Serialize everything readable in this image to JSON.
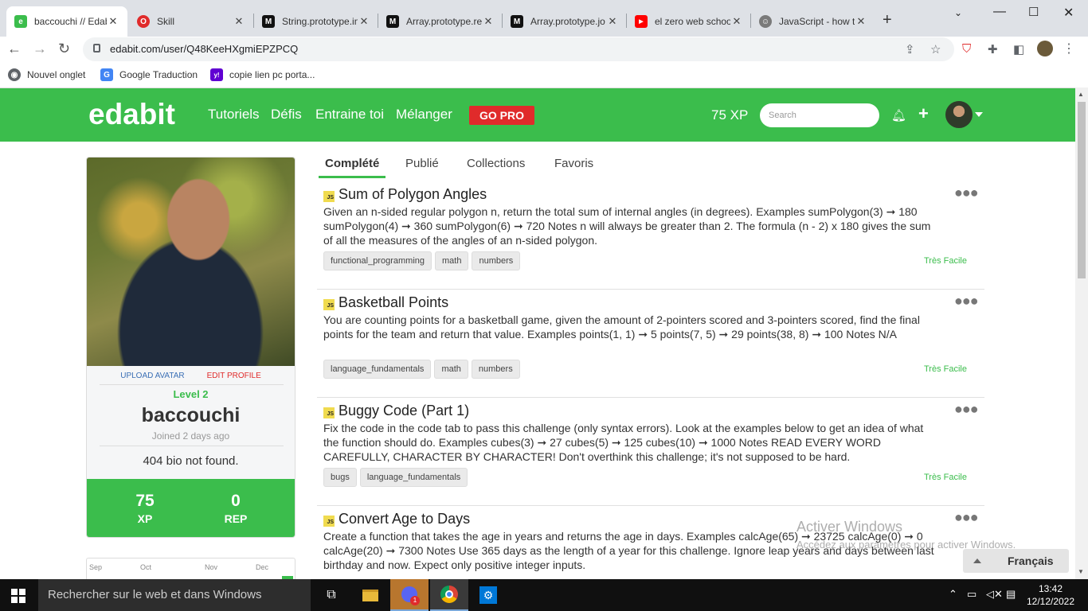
{
  "browser": {
    "tabs": [
      {
        "title": "baccouchi // Edabit",
        "fav_color": "#3bbd4c",
        "fav_glyph": "e"
      },
      {
        "title": "Skill",
        "fav_color": "#e02b2b",
        "fav_glyph": "O"
      },
      {
        "title": "String.prototype.in",
        "fav_color": "#111111",
        "fav_glyph": "M"
      },
      {
        "title": "Array.prototype.re",
        "fav_color": "#111111",
        "fav_glyph": "M"
      },
      {
        "title": "Array.prototype.jo",
        "fav_color": "#111111",
        "fav_glyph": "M"
      },
      {
        "title": "el zero web schoo",
        "fav_color": "#ff0000",
        "fav_glyph": "▶"
      },
      {
        "title": "JavaScript - how t",
        "fav_color": "#7a7a7a",
        "fav_glyph": "☺"
      }
    ],
    "url": "edabit.com/user/Q48KeeHXgmiEPZPCQ",
    "bookmarks": [
      {
        "label": "Nouvel onglet",
        "color": "#5f6368",
        "glyph": "◉"
      },
      {
        "label": "Google Traduction",
        "color": "#4285f4",
        "glyph": "G"
      },
      {
        "label": "copie lien pc porta...",
        "color": "#6001d2",
        "glyph": "y!"
      }
    ]
  },
  "site": {
    "logo": "edabit",
    "nav": [
      "Tutoriels",
      "Défis",
      "Entraine toi",
      "Mélanger"
    ],
    "gopro": "GO PRO",
    "xp": "75 XP",
    "search_placeholder": "Search"
  },
  "profile": {
    "upload_avatar": "UPLOAD AVATAR",
    "edit_profile": "EDIT PROFILE",
    "level": "Level 2",
    "username": "baccouchi",
    "joined": "Joined 2 days ago",
    "bio": "404 bio not found.",
    "xp_value": "75",
    "xp_label": "XP",
    "rep_value": "0",
    "rep_label": "REP",
    "activity_months": [
      "Sep",
      "Oct",
      "Nov",
      "Dec"
    ]
  },
  "profile_tabs": [
    "Complété",
    "Publié",
    "Collections",
    "Favoris"
  ],
  "challenges": [
    {
      "lang": "JS",
      "title": "Sum of Polygon Angles",
      "desc": "Given an n-sided regular polygon n, return the total sum of internal angles (in degrees). Examples sumPolygon(3) ➞ 180 sumPolygon(4) ➞ 360 sumPolygon(6) ➞ 720 Notes n will always be greater than 2. The formula (n - 2) x 180 gives the sum of all the measures of the angles of an n-sided polygon.",
      "tags": [
        "functional_programming",
        "math",
        "numbers"
      ],
      "difficulty": "Très Facile"
    },
    {
      "lang": "JS",
      "title": "Basketball Points",
      "desc": "You are counting points for a basketball game, given the amount of 2-pointers scored and 3-pointers scored, find the final points for the team and return that value. Examples points(1, 1) ➞ 5 points(7, 5) ➞ 29 points(38, 8) ➞ 100 Notes N/A",
      "tags": [
        "language_fundamentals",
        "math",
        "numbers"
      ],
      "difficulty": "Très Facile"
    },
    {
      "lang": "JS",
      "title": "Buggy Code (Part 1)",
      "desc": "Fix the code in the code tab to pass this challenge (only syntax errors). Look at the examples below to get an idea of what the function should do. Examples cubes(3) ➞ 27 cubes(5) ➞ 125 cubes(10) ➞ 1000 Notes READ EVERY WORD CAREFULLY, CHARACTER BY CHARACTER! Don't overthink this challenge; it's not supposed to be hard.",
      "tags": [
        "bugs",
        "language_fundamentals"
      ],
      "difficulty": "Très Facile"
    },
    {
      "lang": "JS",
      "title": "Convert Age to Days",
      "desc": "Create a function that takes the age in years and returns the age in days. Examples calcAge(65) ➞ 23725 calcAge(0) ➞ 0 calcAge(20) ➞ 7300 Notes Use 365 days as the length of a year for this challenge. Ignore leap years and days between last birthday and now. Expect only positive integer inputs.",
      "tags": [],
      "difficulty": ""
    }
  ],
  "watermark": {
    "line1": "Activer Windows",
    "line2": "Accédez aux paramètres pour activer Windows."
  },
  "language_button": "Français",
  "taskbar": {
    "search": "Rechercher sur le web et dans Windows",
    "time": "13:42",
    "date": "12/12/2022",
    "badge": "1"
  },
  "colors": {
    "brand": "#3bbd4c",
    "gopro": "#e02b2b",
    "link": "#3a6fb5"
  }
}
